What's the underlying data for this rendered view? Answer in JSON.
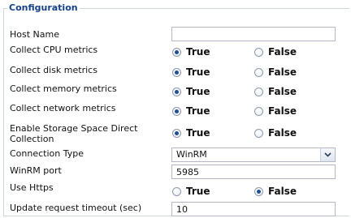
{
  "section": {
    "title": "Configuration"
  },
  "fields": {
    "host_name": {
      "label": "Host Name",
      "value": ""
    },
    "cpu": {
      "label": "Collect CPU metrics",
      "true_label": "True",
      "false_label": "False",
      "selected": "True"
    },
    "disk": {
      "label": "Collect disk metrics",
      "true_label": "True",
      "false_label": "False",
      "selected": "True"
    },
    "memory": {
      "label": "Collect memory metrics",
      "true_label": "True",
      "false_label": "False",
      "selected": "True"
    },
    "network": {
      "label": "Collect network metrics",
      "true_label": "True",
      "false_label": "False",
      "selected": "True"
    },
    "storage": {
      "label_line1": "Enable Storage Space Direct",
      "label_line2": "Collection",
      "true_label": "True",
      "false_label": "False",
      "selected": "True"
    },
    "connection_type": {
      "label": "Connection Type",
      "value": "WinRM"
    },
    "winrm_port": {
      "label": "WinRM port",
      "value": "5985"
    },
    "https": {
      "label": "Use Https",
      "true_label": "True",
      "false_label": "False",
      "selected": "False"
    },
    "timeout": {
      "label": "Update request timeout (sec)",
      "value": "10"
    }
  },
  "colors": {
    "legend": "#15428b",
    "radio_dot": "#1e4f96",
    "border": "#b5b8c8"
  },
  "icons": {
    "dropdown": "chevron-down-icon"
  }
}
